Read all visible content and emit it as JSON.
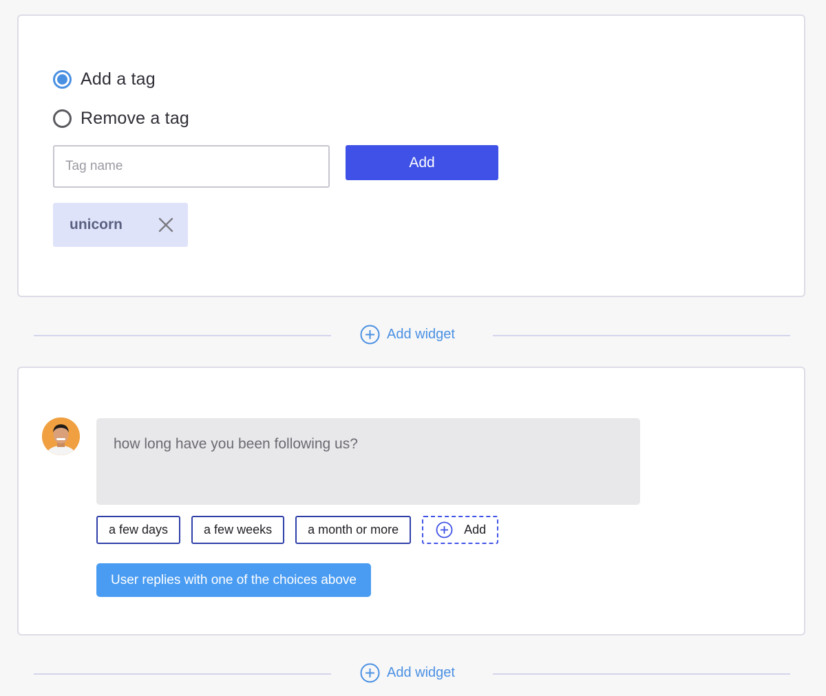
{
  "tag_widget": {
    "options": [
      {
        "label": "Add a tag",
        "selected": true
      },
      {
        "label": "Remove a tag",
        "selected": false
      }
    ],
    "input": {
      "placeholder": "Tag name",
      "value": ""
    },
    "add_button_label": "Add",
    "tags": [
      {
        "label": "unicorn"
      }
    ]
  },
  "add_widget_label": "Add widget",
  "chat_widget": {
    "message": "how long have you been following us?",
    "choices": [
      "a few days",
      "a few weeks",
      "a month or more"
    ],
    "add_choice_label": "Add",
    "reply_mode_label": "User replies with one of the choices above"
  },
  "colors": {
    "primary": "#3f51e6",
    "accent": "#4a90e2",
    "reply_button": "#4a9cf2",
    "chip_background": "#dfe3fa"
  },
  "icons": {
    "add_widget": "plus-circle-icon",
    "remove_tag": "close-icon",
    "add_choice": "plus-circle-icon"
  }
}
